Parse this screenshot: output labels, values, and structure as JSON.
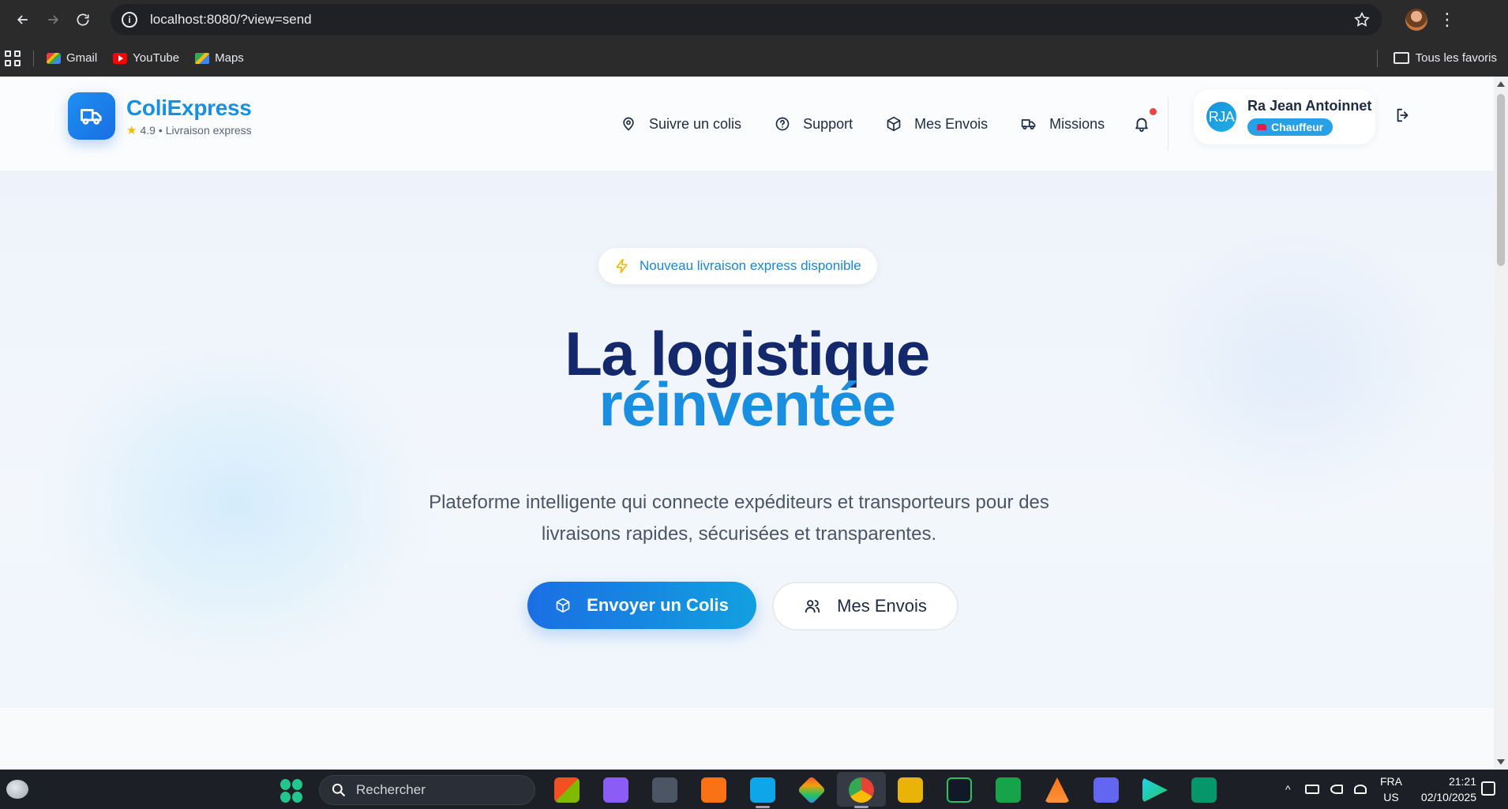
{
  "browser": {
    "url": "localhost:8080/?view=send",
    "bookmarks": [
      {
        "label": "Gmail",
        "icon": "gmail-icon"
      },
      {
        "label": "YouTube",
        "icon": "youtube-icon"
      },
      {
        "label": "Maps",
        "icon": "maps-icon"
      }
    ],
    "all_bookmarks_label": "Tous les favoris"
  },
  "app": {
    "brand_name": "ColiExpress",
    "rating": "4.9",
    "tagline": "• Livraison express",
    "nav": [
      {
        "label": "Suivre un colis",
        "icon": "map-pin-icon"
      },
      {
        "label": "Support",
        "icon": "help-circle-icon"
      },
      {
        "label": "Mes Envois",
        "icon": "package-icon"
      },
      {
        "label": "Missions",
        "icon": "truck-icon"
      }
    ],
    "notifications_unread": true,
    "user": {
      "initials": "RJA",
      "name": "Ra Jean Antoinnet",
      "role": "Chauffeur"
    }
  },
  "hero": {
    "badge": "Nouveau livraison express disponible",
    "title_line1": "La logistique",
    "title_line2": "réinventée",
    "description": "Plateforme intelligente qui connecte expéditeurs et transporteurs pour des livraisons rapides, sécurisées et transparentes.",
    "primary_cta": "Envoyer un Colis",
    "secondary_cta": "Mes Envois"
  },
  "taskbar": {
    "search_placeholder": "Rechercher",
    "lang_line1": "FRA",
    "lang_line2": "US",
    "time": "21:21",
    "date": "02/10/2025"
  },
  "colors": {
    "brand_blue": "#1a8fe0",
    "title_navy": "#13296b",
    "notification_dot": "#ef4444",
    "badge_star": "#f5b800"
  }
}
